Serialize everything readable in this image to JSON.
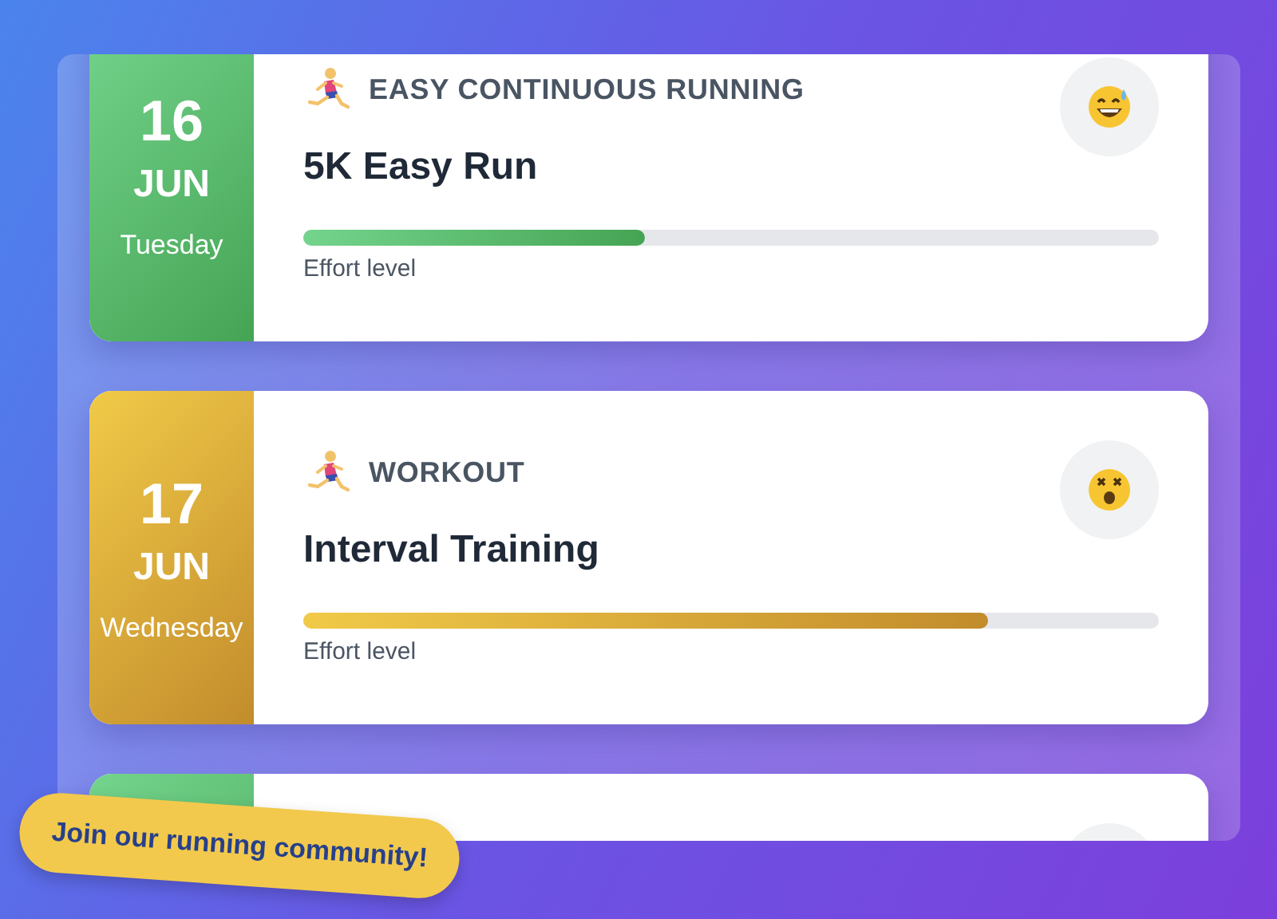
{
  "cards": [
    {
      "kind": "easy",
      "day": "16",
      "month": "JUN",
      "weekday": "Tuesday",
      "runner": true,
      "category": "EASY CONTINUOUS RUNNING",
      "title": "5K Easy Run",
      "level": 0.4,
      "effort_label": "Effort level",
      "mood": {
        "kind": "sweat"
      }
    },
    {
      "kind": "workout",
      "day": "17",
      "month": "JUN",
      "weekday": "Wednesday",
      "runner": true,
      "category": "WORKOUT",
      "title": "Interval Training",
      "level": 0.8,
      "effort_label": "Effort level",
      "mood": {
        "kind": "dizzy"
      }
    },
    {
      "kind": "easy"
    }
  ],
  "banner": {
    "text": "Join our running community!"
  }
}
